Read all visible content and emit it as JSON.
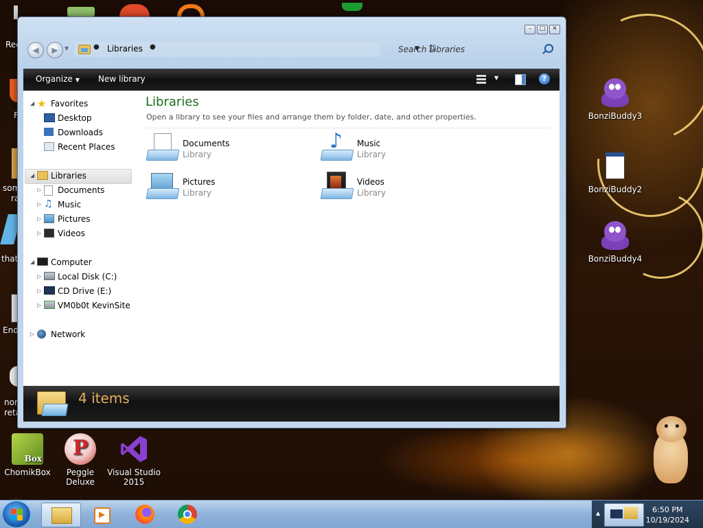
{
  "desktop": {
    "icons_left_partial": [
      "Rec",
      "F",
      "som",
      "ra",
      "that",
      "End",
      "non",
      "reta"
    ],
    "icons_right": [
      {
        "label": "BonziBuddy3"
      },
      {
        "label": "BonziBuddy2"
      },
      {
        "label": "BonziBuddy4"
      }
    ],
    "icons_bottom": [
      {
        "label": "ChomikBox"
      },
      {
        "label": "Peggle Deluxe"
      },
      {
        "label": "Visual Studio 2015"
      }
    ]
  },
  "explorer": {
    "address": {
      "crumb": "Libraries"
    },
    "search_placeholder": "Search Libraries",
    "toolbar": {
      "organize": "Organize",
      "new_library": "New library"
    },
    "nav": {
      "favorites": "Favorites",
      "desktop": "Desktop",
      "downloads": "Downloads",
      "recent_places": "Recent Places",
      "libraries": "Libraries",
      "documents": "Documents",
      "music": "Music",
      "pictures": "Pictures",
      "videos": "Videos",
      "computer": "Computer",
      "local_disk": "Local Disk (C:)",
      "cd_drive": "CD Drive (E:)",
      "net_share": "VM0b0t KevinSite",
      "network": "Network"
    },
    "main": {
      "title": "Libraries",
      "subtitle": "Open a library to see your files and arrange them by folder, date, and other properties.",
      "libraries": [
        {
          "name": "Documents",
          "kind": "Library"
        },
        {
          "name": "Music",
          "kind": "Library"
        },
        {
          "name": "Pictures",
          "kind": "Library"
        },
        {
          "name": "Videos",
          "kind": "Library"
        }
      ]
    },
    "details": {
      "count": "4 items"
    }
  },
  "taskbar": {
    "clock": {
      "time": "6:50 PM",
      "date": "10/19/2024"
    }
  }
}
